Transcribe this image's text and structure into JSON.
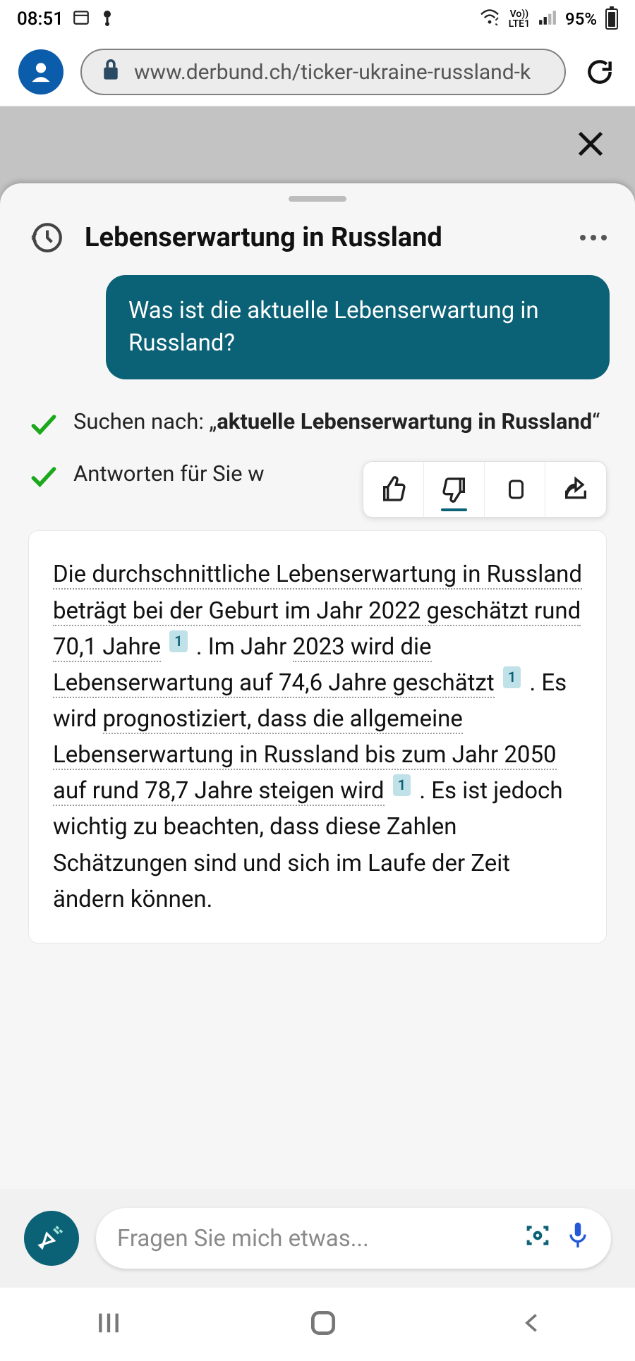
{
  "statusbar": {
    "time": "08:51",
    "net_label": "LTE1",
    "vo_label": "Vo))",
    "battery_pct": "95%"
  },
  "chrome": {
    "url": "www.derbund.ch/ticker-ukraine-russland-k"
  },
  "sheet": {
    "title": "Lebenserwartung in Russland",
    "user_prompt": "Was ist die aktuelle Lebenserwartung in Russland?",
    "step1_prefix": "Suchen nach: „",
    "step1_bold": "aktuelle Lebenserwartung in Russland",
    "step1_suffix": "“",
    "step2": "Antworten für Sie w",
    "answer_parts": {
      "d1": "Die durchschnittliche Lebenserwartung in Russland beträgt bei der Geburt im Jahr 2022 geschätzt rund 70,1 Jahre",
      "p1": " . Im Jahr ",
      "d2": "2023 wird die Lebenserwartung auf 74,6 Jahre geschätzt",
      "p2": " . Es wird ",
      "d3": "prognostiziert, dass die allgemeine Lebenserwartung in Russland bis zum Jahr 2050 auf rund 78,7 Jahre steigen wird",
      "p3": " . Es ist jedoch wichtig zu beachten, dass diese Zahlen Schätzungen sind und sich im Laufe der Zeit ändern können."
    },
    "ref1": "1",
    "ref2": "1",
    "ref3": "1"
  },
  "compose": {
    "placeholder": "Fragen Sie mich etwas..."
  }
}
